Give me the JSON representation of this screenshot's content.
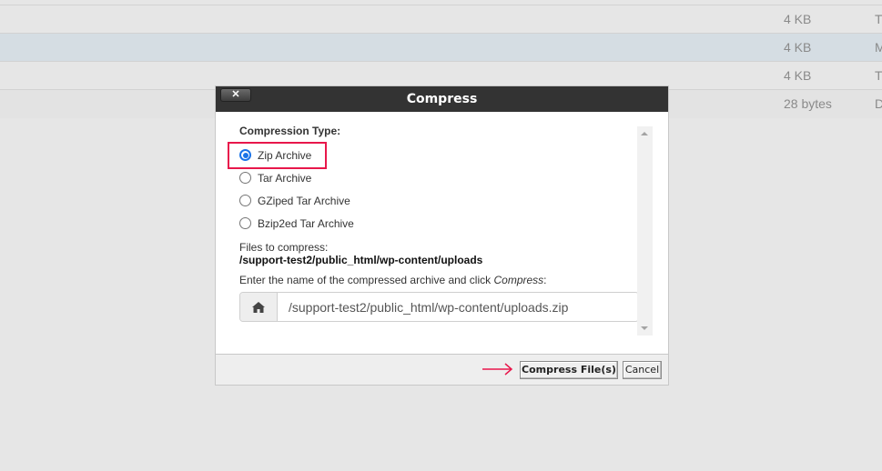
{
  "background_table": {
    "rows": [
      {
        "size": "4 KB",
        "type": "T",
        "selected": false
      },
      {
        "size": "4 KB",
        "type": "M",
        "selected": true
      },
      {
        "size": "4 KB",
        "type": "T",
        "selected": false
      },
      {
        "size": "28 bytes",
        "type": "D",
        "selected": false
      }
    ]
  },
  "dialog": {
    "title": "Compress",
    "close_label": "✕",
    "compression_type_label": "Compression Type:",
    "options": [
      {
        "label": "Zip Archive",
        "checked": true
      },
      {
        "label": "Tar Archive",
        "checked": false
      },
      {
        "label": "GZiped Tar Archive",
        "checked": false
      },
      {
        "label": "Bzip2ed Tar Archive",
        "checked": false
      }
    ],
    "files_label": "Files to compress:",
    "files_path": "/support-test2/public_html/wp-content/uploads",
    "enter_label_prefix": "Enter the name of the compressed archive and click ",
    "enter_label_emph": "Compress",
    "enter_label_suffix": ":",
    "archive_name": "/support-test2/public_html/wp-content/uploads.zip",
    "home_icon": "home-icon",
    "compress_button": "Compress File(s)",
    "cancel_button": "Cancel",
    "highlight_color": "#e8174b"
  }
}
